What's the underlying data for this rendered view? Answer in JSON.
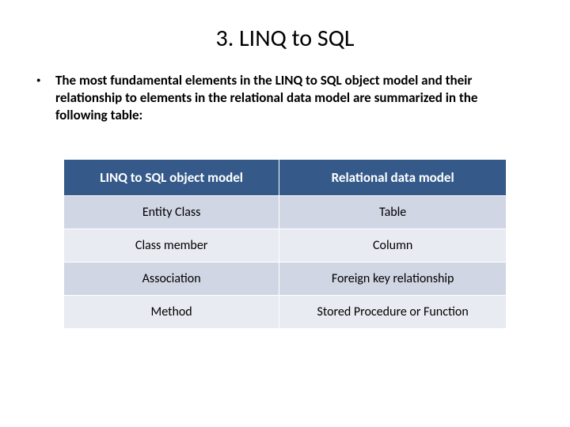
{
  "title": "3. LINQ to SQL",
  "bullet": "The most fundamental elements in the LINQ to SQL object model and their relationship to elements in the relational data model are summarized in the following table:",
  "table": {
    "headers": [
      "LINQ to SQL object model",
      "Relational data model"
    ],
    "rows": [
      [
        "Entity Class",
        "Table"
      ],
      [
        "Class member",
        "Column"
      ],
      [
        "Association",
        "Foreign key relationship"
      ],
      [
        "Method",
        "Stored Procedure or Function"
      ]
    ]
  }
}
